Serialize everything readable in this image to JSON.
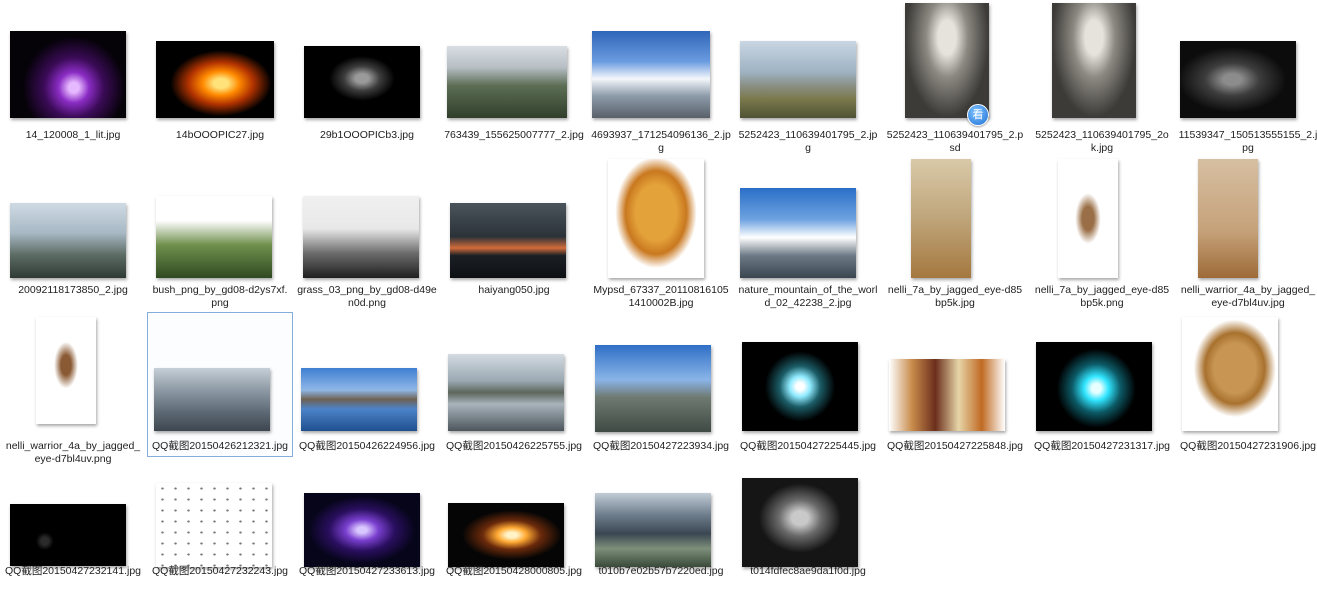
{
  "files": [
    {
      "label": "14_120008_1_lit.jpg",
      "image": "purple-orb-logo",
      "palette": "t-orb"
    },
    {
      "label": "14bOOOPIC27.jpg",
      "image": "fire-bird-on-black",
      "palette": "t-fire"
    },
    {
      "label": "29b1OOOPICb3.jpg",
      "image": "smoke-puff-on-black",
      "palette": "t-smoke"
    },
    {
      "label": "763439_155625007777_2.jpg",
      "image": "karst-mountains",
      "palette": "t-karst"
    },
    {
      "label": "4693937_171254096136_2.jpg",
      "image": "snowy-alp-peak",
      "palette": "t-alps"
    },
    {
      "label": "5252423_110639401795_2.jpg",
      "image": "coastal-grassland",
      "palette": "t-coast"
    },
    {
      "label": "5252423_110639401795_2.psd",
      "image": "warrior-woman-storm",
      "palette": "t-warrior",
      "badge": "看"
    },
    {
      "label": "5252423_110639401795_2ok.jpg",
      "image": "warrior-woman-storm",
      "palette": "t-warrior"
    },
    {
      "label": "11539347_150513555155_2.jpg",
      "image": "smoke-wisps-dark",
      "palette": "t-wisp"
    },
    {
      "label": "20092118173850_2.jpg",
      "image": "misty-peaks",
      "palette": "t-peaks"
    },
    {
      "label": "bush_png_by_gd08-d2ys7xf.png",
      "image": "green-bush",
      "palette": "t-bush"
    },
    {
      "label": "grass_03_png_by_gd08-d49en0d.png",
      "image": "grass-silhouette",
      "palette": "t-grass"
    },
    {
      "label": "haiyang050.jpg",
      "image": "dark-sea-sunset",
      "palette": "t-sea"
    },
    {
      "label": "Mypsd_67337_201108161051410002B.jpg",
      "image": "maple-leaf",
      "palette": "t-leaf"
    },
    {
      "label": "nature_mountain_of_the_world_02_42238_2.jpg",
      "image": "snow-mountain",
      "palette": "t-snow"
    },
    {
      "label": "nelli_7a_by_jagged_eye-d85bp5k.jpg",
      "image": "nelli-room",
      "palette": "t-nelli"
    },
    {
      "label": "nelli_7a_by_jagged_eye-d85bp5k.png",
      "image": "nelli-cutout",
      "palette": "t-nelli2"
    },
    {
      "label": "nelli_warrior_4a_by_jagged_eye-d7bl4uv.jpg",
      "image": "nelli-warrior-room",
      "palette": "t-nelli3"
    },
    {
      "label": "nelli_warrior_4a_by_jagged_eye-d7bl4uv.png",
      "image": "nelli-warrior-cutout",
      "palette": "t-nelli4"
    },
    {
      "label": "QQ截图20150426212321.jpg",
      "image": "cloudy-sky",
      "palette": "t-cloud",
      "selected": true
    },
    {
      "label": "QQ截图20150426224956.jpg",
      "image": "mountain-lake",
      "palette": "t-lake"
    },
    {
      "label": "QQ截图20150426225755.jpg",
      "image": "lake-reflection",
      "palette": "t-lake2"
    },
    {
      "label": "QQ截图20150427223934.jpg",
      "image": "domed-cathedral",
      "palette": "t-dome"
    },
    {
      "label": "QQ截图20150427225445.jpg",
      "image": "glowing-ring",
      "palette": "t-ring"
    },
    {
      "label": "QQ截图20150427225848.jpg",
      "image": "four-leaves",
      "palette": "t-leaves"
    },
    {
      "label": "QQ截图20150427231317.jpg",
      "image": "cyan-plasma-ball",
      "palette": "t-plasma"
    },
    {
      "label": "QQ截图20150427231906.jpg",
      "image": "dry-leaf",
      "palette": "t-bigleaf"
    },
    {
      "label": "QQ截图20150427232141.jpg",
      "image": "dark-particles",
      "palette": "t-bits"
    },
    {
      "label": "QQ截图20150427232243.jpg",
      "image": "scattered-dots",
      "palette": "t-dots"
    },
    {
      "label": "QQ截图20150427233613.jpg",
      "image": "purple-nebula",
      "palette": "t-nebula"
    },
    {
      "label": "QQ截图20150428000805.jpg",
      "image": "sparks",
      "palette": "t-spark"
    },
    {
      "label": "t010b7e02b57b7220ed.jpg",
      "image": "storm-cloud",
      "palette": "t-storm"
    },
    {
      "label": "t014fdfec8ae9da1f0d.jpg",
      "image": "smoke-cloud",
      "palette": "t-smoke2"
    }
  ]
}
